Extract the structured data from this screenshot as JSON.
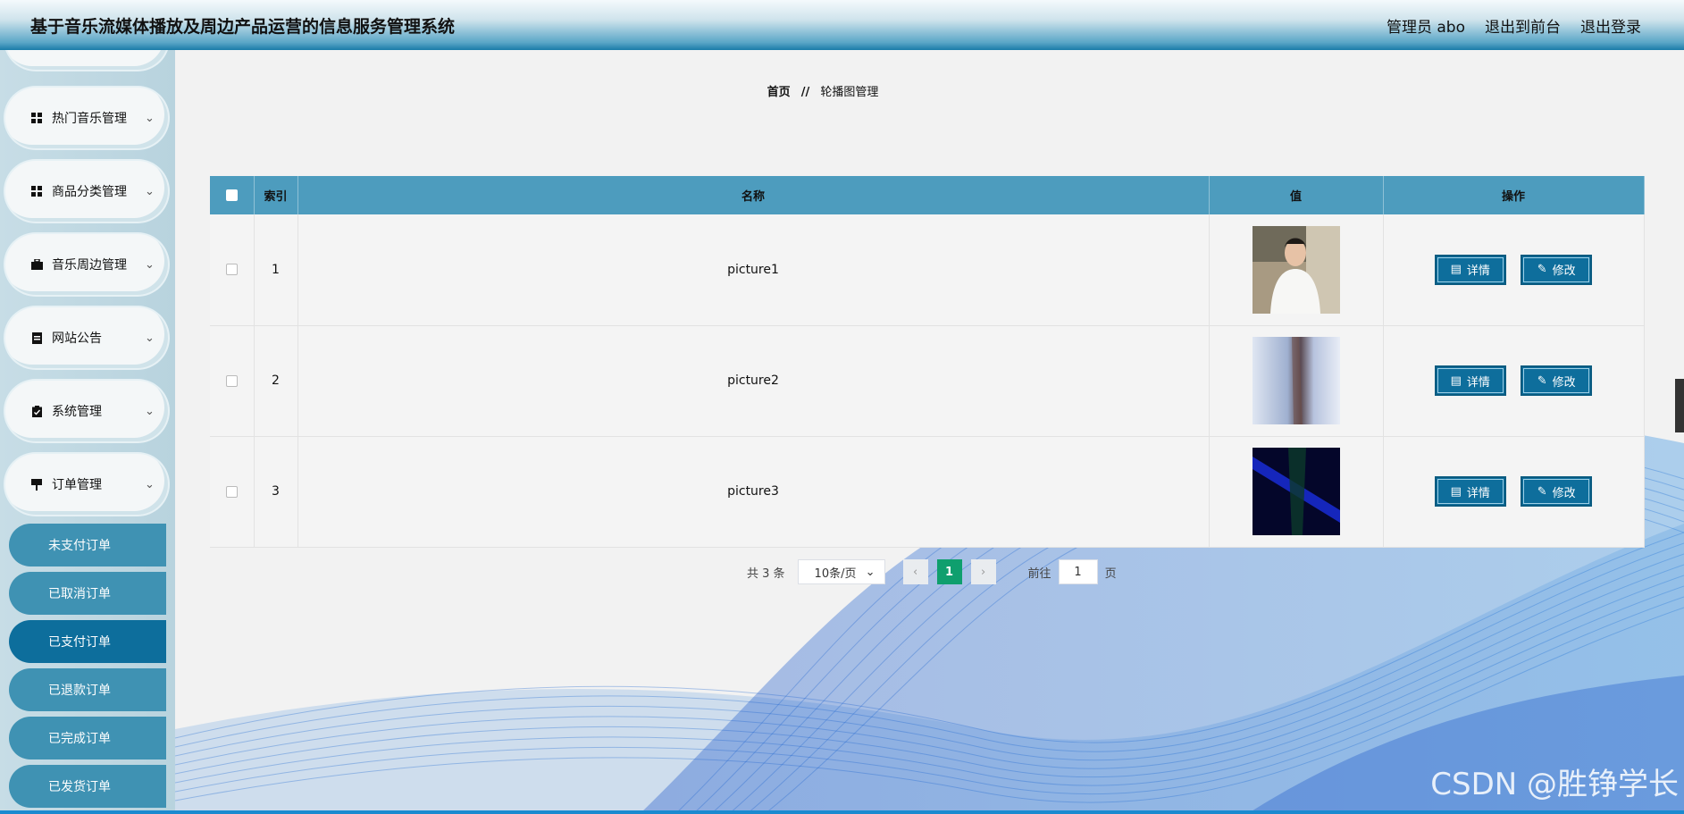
{
  "header": {
    "title": "基于音乐流媒体播放及周边产品运营的信息服务管理系统",
    "user": "管理员 abo",
    "back_front": "退出到前台",
    "logout": "退出登录"
  },
  "sidebar": {
    "menus": [
      {
        "label": "热门音乐管理",
        "icon": "grid-icon"
      },
      {
        "label": "商品分类管理",
        "icon": "grid-icon"
      },
      {
        "label": "音乐周边管理",
        "icon": "briefcase-icon"
      },
      {
        "label": "网站公告",
        "icon": "document-icon"
      },
      {
        "label": "系统管理",
        "icon": "clipboard-icon"
      },
      {
        "label": "订单管理",
        "icon": "flag-icon"
      }
    ],
    "sub_items": [
      {
        "label": "未支付订单"
      },
      {
        "label": "已取消订单"
      },
      {
        "label": "已支付订单"
      },
      {
        "label": "已退款订单"
      },
      {
        "label": "已完成订单"
      },
      {
        "label": "已发货订单"
      }
    ],
    "active_sub": "已支付订单"
  },
  "breadcrumb": {
    "home": "首页",
    "separator": "//",
    "current": "轮播图管理"
  },
  "table": {
    "headers": {
      "index": "索引",
      "name": "名称",
      "value": "值",
      "actions": "操作"
    },
    "rows": [
      {
        "index": "1",
        "name": "picture1",
        "image": "portrait-white-shirt"
      },
      {
        "index": "2",
        "name": "picture2",
        "image": "blurred-figure-light"
      },
      {
        "index": "3",
        "name": "picture3",
        "image": "stage-dark-blue"
      }
    ],
    "detail_label": "详情",
    "edit_label": "修改"
  },
  "pagination": {
    "total_text": "共 3 条",
    "page_size": "10条/页",
    "current_page": "1",
    "goto_prefix": "前往",
    "goto_value": "1",
    "goto_suffix": "页"
  },
  "watermark": "CSDN @胜铮学长",
  "colors": {
    "header_accent": "#1a7ca8",
    "table_header": "#4d9cbe",
    "button": "#0e6e9c",
    "active_page": "#0f9f6e",
    "sub_item": "#3f92b3",
    "sub_item_active": "#0d6e9c"
  }
}
